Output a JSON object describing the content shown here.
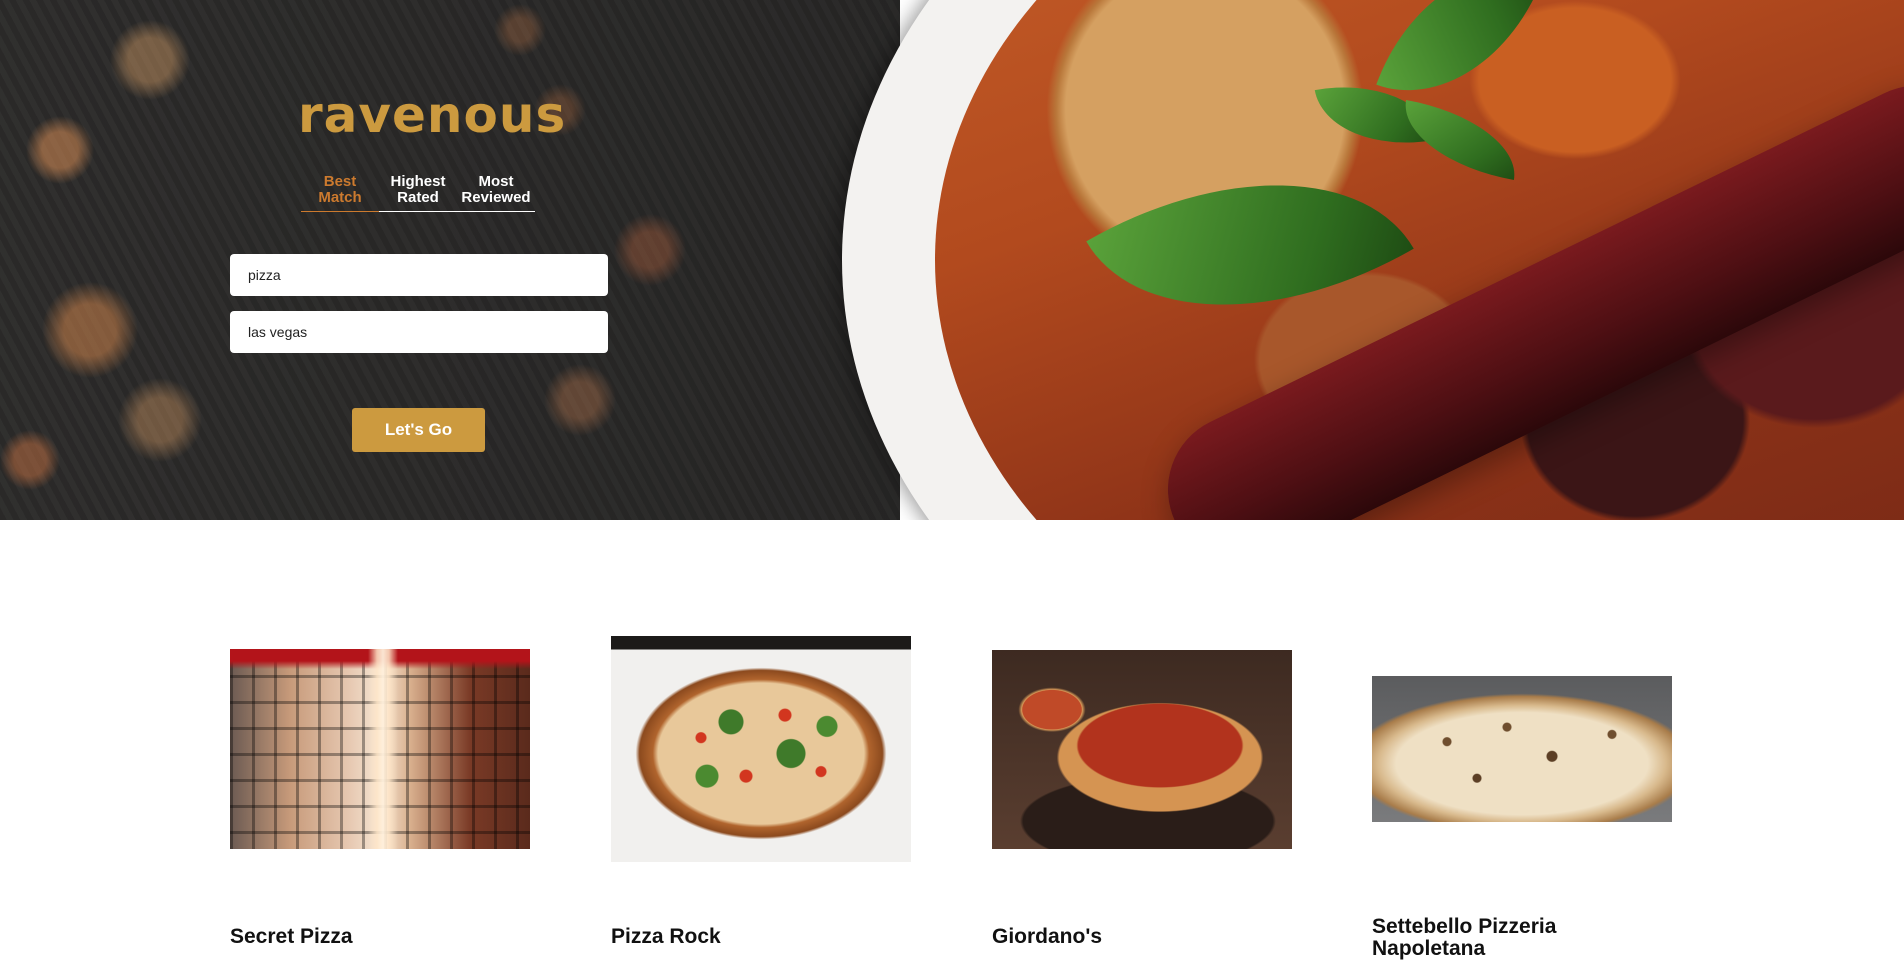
{
  "brand": {
    "name": "ravenous"
  },
  "sort_options": [
    {
      "label": "Best\nMatch",
      "active": true
    },
    {
      "label": "Highest\nRated",
      "active": false
    },
    {
      "label": "Most\nReviewed",
      "active": false
    }
  ],
  "search": {
    "term_value": "pizza",
    "location_value": "las vegas",
    "submit_label": "Let's Go"
  },
  "colors": {
    "brand_gold": "#cc9a3f",
    "active_tab": "#cc7a2e"
  },
  "businesses": [
    {
      "name": "Secret Pizza"
    },
    {
      "name": "Pizza Rock"
    },
    {
      "name": "Giordano's"
    },
    {
      "name": "Settebello Pizzeria Napoletana"
    }
  ]
}
